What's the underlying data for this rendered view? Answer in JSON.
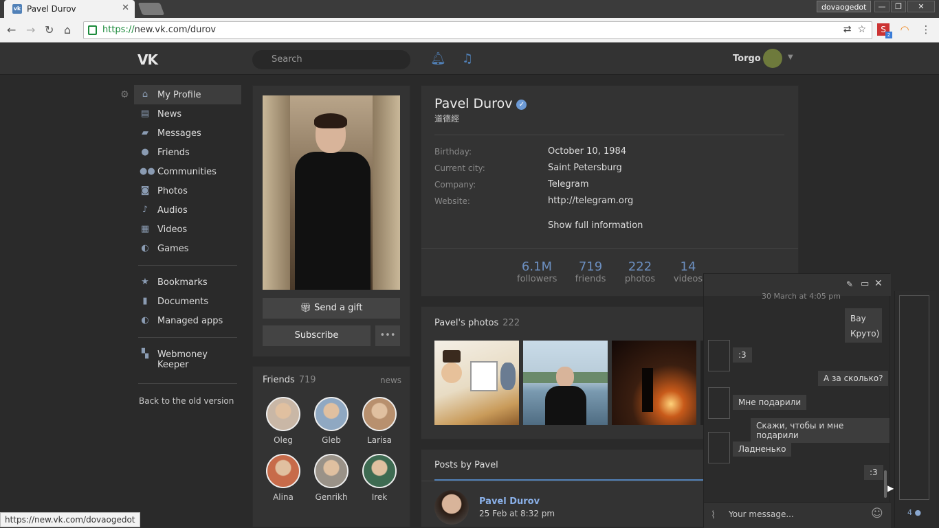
{
  "browser": {
    "tab_title": "Pavel Durov",
    "tab_close": "✕",
    "profile_name": "dovaogedot",
    "url_scheme": "https://",
    "url_rest": "new.vk.com/durov",
    "status_url": "https://new.vk.com/dovaogedot",
    "ext_badge": "2"
  },
  "header": {
    "logo": "VK",
    "search_placeholder": "Search",
    "user_name": "Torgo"
  },
  "sidebar": {
    "items": [
      {
        "label": "My Profile",
        "icon": "home-icon"
      },
      {
        "label": "News",
        "icon": "news-icon"
      },
      {
        "label": "Messages",
        "icon": "messages-icon"
      },
      {
        "label": "Friends",
        "icon": "friends-icon"
      },
      {
        "label": "Communities",
        "icon": "communities-icon"
      },
      {
        "label": "Photos",
        "icon": "camera-icon"
      },
      {
        "label": "Audios",
        "icon": "music-icon"
      },
      {
        "label": "Videos",
        "icon": "film-icon"
      },
      {
        "label": "Games",
        "icon": "gamepad-icon"
      }
    ],
    "items2": [
      {
        "label": "Bookmarks",
        "icon": "star-icon"
      },
      {
        "label": "Documents",
        "icon": "document-icon"
      },
      {
        "label": "Managed apps",
        "icon": "gamepad-icon"
      }
    ],
    "items3": [
      {
        "label": "Webmoney Keeper",
        "icon": "grid-icon"
      }
    ],
    "back_link": "Back to the old version"
  },
  "profile": {
    "name": "Pavel Durov",
    "status": "道德經",
    "send_gift": "Send a gift",
    "subscribe": "Subscribe",
    "more": "•••",
    "info": [
      {
        "label": "Birthday:",
        "value": "October 10, 1984"
      },
      {
        "label": "Current city:",
        "value": "Saint Petersburg"
      },
      {
        "label": "Company:",
        "value": "Telegram"
      },
      {
        "label": "Website:",
        "value": "http://telegram.org"
      }
    ],
    "show_full": "Show full information",
    "stats": [
      {
        "num": "6.1M",
        "label": "followers"
      },
      {
        "num": "719",
        "label": "friends"
      },
      {
        "num": "222",
        "label": "photos"
      },
      {
        "num": "14",
        "label": "videos"
      }
    ]
  },
  "photos": {
    "title": "Pavel's photos",
    "count": "222"
  },
  "friends": {
    "title": "Friends",
    "count": "719",
    "news_link": "news",
    "list": [
      {
        "name": "Oleg",
        "color": "#c9b7a6"
      },
      {
        "name": "Gleb",
        "color": "#8fa8c2"
      },
      {
        "name": "Larisa",
        "color": "#b8906e"
      },
      {
        "name": "Alina",
        "color": "#c76b4a"
      },
      {
        "name": "Genrikh",
        "color": "#9a9288"
      },
      {
        "name": "Irek",
        "color": "#3e6b52"
      }
    ]
  },
  "posts": {
    "tab": "Posts by Pavel",
    "author": "Pavel Durov",
    "date": "25 Feb at 8:32 pm"
  },
  "chat": {
    "timestamp": "30 March at 4:05 pm",
    "messages": [
      {
        "text": "Вау"
      },
      {
        "text": "Круто)"
      },
      {
        "text": ":3"
      },
      {
        "text": "А за сколько?"
      },
      {
        "text": "Мне подарили"
      },
      {
        "text": "Скажи, чтобы и мне подарили"
      },
      {
        "text": "Ладненько"
      },
      {
        "text": ":3"
      }
    ],
    "input_placeholder": "Your message...",
    "online_count": "4"
  }
}
